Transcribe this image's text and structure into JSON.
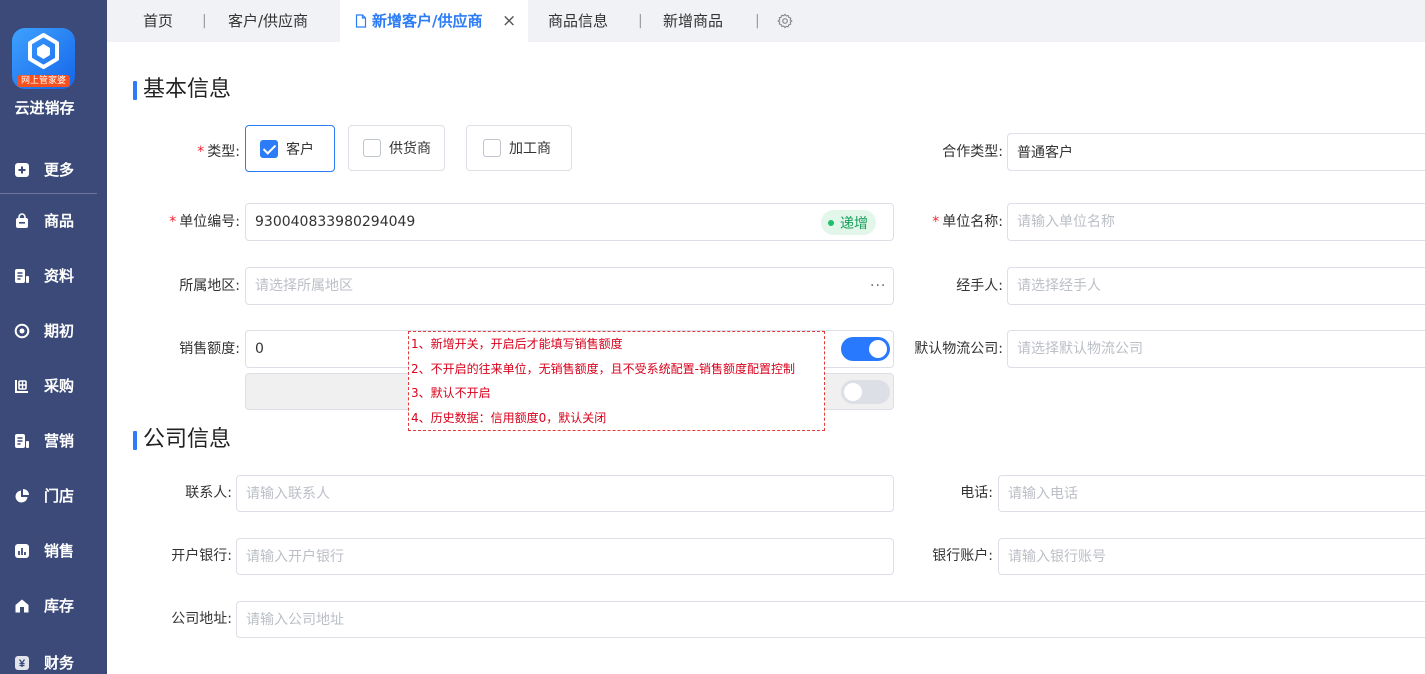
{
  "theme": {
    "accent": "#2b7cf6",
    "sidebar": "#3b4a78",
    "annotation_red": "#d9001b",
    "switch_on": "#2979ff",
    "badge_green": "#16a05a"
  },
  "app": {
    "logo_badge": "网上管家婆",
    "name": "云进销存"
  },
  "sidebar": {
    "items": [
      {
        "label": "更多",
        "icon": "plus-square-icon"
      },
      {
        "label": "商品",
        "icon": "bag-icon"
      },
      {
        "label": "资料",
        "icon": "document-icon"
      },
      {
        "label": "期初",
        "icon": "target-icon"
      },
      {
        "label": "采购",
        "icon": "purchase-icon"
      },
      {
        "label": "营销",
        "icon": "marketing-icon"
      },
      {
        "label": "门店",
        "icon": "pie-chart-icon"
      },
      {
        "label": "销售",
        "icon": "bar-chart-icon"
      },
      {
        "label": "库存",
        "icon": "house-icon"
      },
      {
        "label": "财务",
        "icon": "yen-icon"
      }
    ]
  },
  "tabs": [
    {
      "label": "首页",
      "active": false
    },
    {
      "label": "客户/供应商",
      "active": false
    },
    {
      "label": "新增客户/供应商",
      "active": true
    },
    {
      "label": "商品信息",
      "active": false
    },
    {
      "label": "新增商品",
      "active": false
    }
  ],
  "tab_separator": "|",
  "tab_close": "×",
  "required_mark": "*",
  "form": {
    "basic": {
      "title": "基本信息",
      "type": {
        "label": "类型:",
        "options": [
          {
            "label": "客户",
            "checked": true
          },
          {
            "label": "供货商",
            "checked": false
          },
          {
            "label": "加工商",
            "checked": false
          }
        ]
      },
      "cooperation_type": {
        "label": "合作类型:",
        "value": "普通客户"
      },
      "unit_code": {
        "label": "单位编号:",
        "value": "930040833980294049",
        "badge": "递增"
      },
      "unit_name": {
        "label": "单位名称:",
        "placeholder": "请输入单位名称"
      },
      "region": {
        "label": "所属地区:",
        "placeholder": "请选择所属地区",
        "more": "···"
      },
      "handler": {
        "label": "经手人:",
        "placeholder": "请选择经手人"
      },
      "sales_limit": {
        "label": "销售额度:",
        "value": "0",
        "switch_on": true
      },
      "sales_limit_secondary": {
        "switch_on": false
      },
      "logistics": {
        "label": "默认物流公司:",
        "placeholder": "请选择默认物流公司"
      }
    },
    "company": {
      "title": "公司信息",
      "contact": {
        "label": "联系人:",
        "placeholder": "请输入联系人"
      },
      "phone": {
        "label": "电话:",
        "placeholder": "请输入电话"
      },
      "bank": {
        "label": "开户银行:",
        "placeholder": "请输入开户银行"
      },
      "account": {
        "label": "银行账户:",
        "placeholder": "请输入银行账号"
      },
      "address": {
        "label": "公司地址:",
        "placeholder": "请输入公司地址"
      }
    }
  },
  "annotation": {
    "lines": [
      "1、新增开关，开启后才能填写销售额度",
      "2、不开启的往来单位，无销售额度，且不受系统配置-销售额度配置控制",
      "3、默认不开启",
      "4、历史数据：信用额度0，默认关闭"
    ]
  }
}
